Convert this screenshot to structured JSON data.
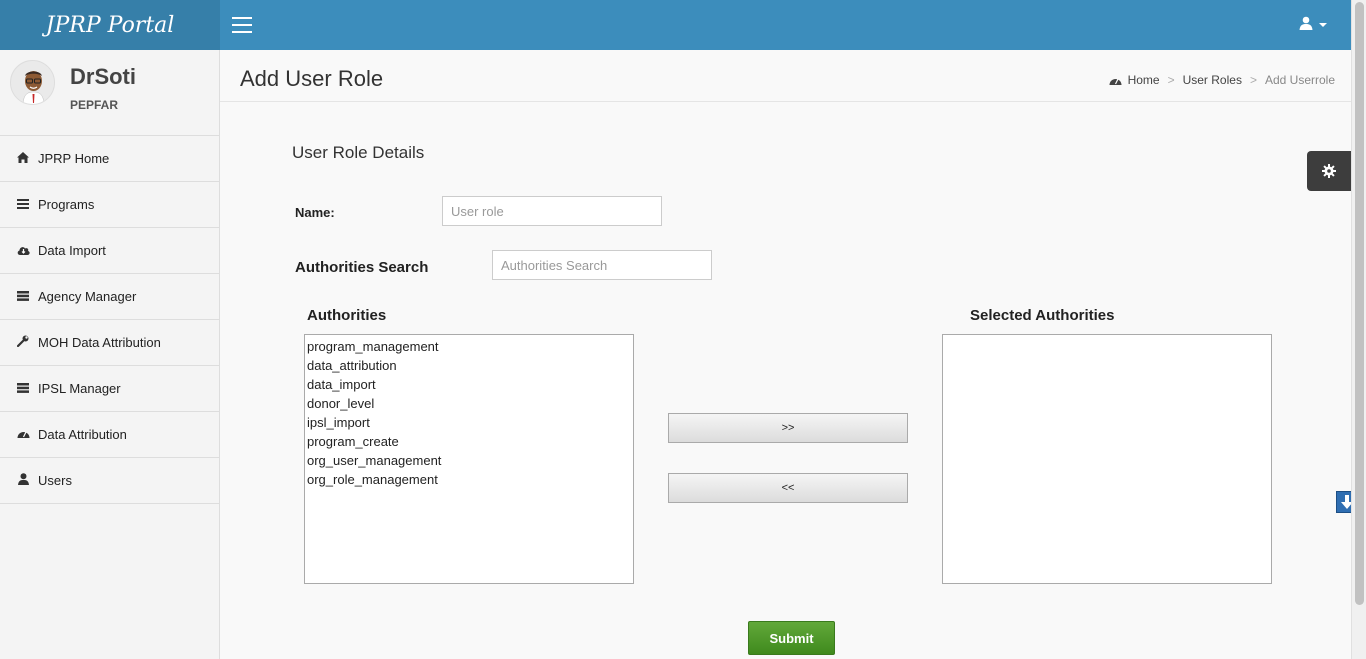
{
  "app": {
    "title": "JPRP Portal"
  },
  "user": {
    "name": "DrSoti",
    "org": "PEPFAR"
  },
  "sidebar": {
    "items": [
      {
        "label": "JPRP Home",
        "icon": "home-icon"
      },
      {
        "label": "Programs",
        "icon": "bars-icon"
      },
      {
        "label": "Data Import",
        "icon": "cloud-download-icon"
      },
      {
        "label": "Agency Manager",
        "icon": "server-icon"
      },
      {
        "label": "MOH Data Attribution",
        "icon": "wrench-icon"
      },
      {
        "label": "IPSL Manager",
        "icon": "server-icon"
      },
      {
        "label": "Data Attribution",
        "icon": "dashboard-icon"
      },
      {
        "label": "Users",
        "icon": "user-icon"
      }
    ]
  },
  "page": {
    "title": "Add User Role",
    "breadcrumb": [
      "Home",
      "User Roles",
      "Add Userrole"
    ]
  },
  "form": {
    "section_title": "User Role Details",
    "name_label": "Name:",
    "name_placeholder": "User role",
    "search_label": "Authorities Search",
    "search_placeholder": "Authorities Search",
    "authorities_label": "Authorities",
    "selected_label": "Selected Authorities",
    "authorities": [
      "program_management",
      "data_attribution",
      "data_import",
      "donor_level",
      "ipsl_import",
      "program_create",
      "org_user_management",
      "org_role_management"
    ],
    "selected_authorities": [],
    "add_button": ">>",
    "remove_button": "<<",
    "submit_button": "Submit"
  },
  "colors": {
    "header": "#3c8dbc",
    "logo_bg": "#367fa9",
    "submit": "#4a9a28"
  }
}
